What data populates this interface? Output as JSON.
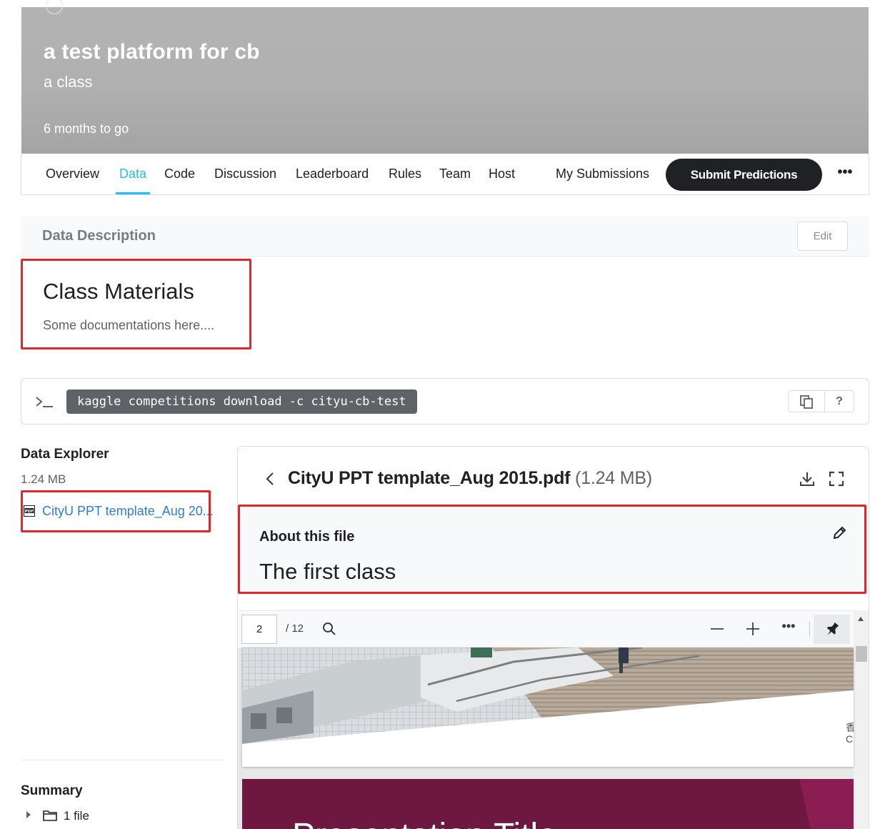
{
  "header": {
    "title": "a test platform for cb",
    "subtitle": "a class",
    "deadline": "6 months to go"
  },
  "tabs": [
    {
      "label": "Overview",
      "active": false
    },
    {
      "label": "Data",
      "active": true
    },
    {
      "label": "Code",
      "active": false
    },
    {
      "label": "Discussion",
      "active": false
    },
    {
      "label": "Leaderboard",
      "active": false
    },
    {
      "label": "Rules",
      "active": false
    },
    {
      "label": "Team",
      "active": false
    },
    {
      "label": "Host",
      "active": false
    },
    {
      "label": "My Submissions",
      "active": false
    }
  ],
  "actions": {
    "submit_label": "Submit Predictions",
    "more_label": "•••"
  },
  "data_description": {
    "title": "Data Description",
    "edit_label": "Edit",
    "heading": "Class Materials",
    "text": "Some documentations here...."
  },
  "command": {
    "text": "kaggle competitions download -c cityu-cb-test",
    "help_label": "?"
  },
  "explorer": {
    "title": "Data Explorer",
    "size": "1.24 MB",
    "files": [
      {
        "name": "CityU PPT template_Aug 2015.pdf",
        "display": "CityU PPT template_Aug 20..."
      }
    ],
    "file_icon_label": "PDF"
  },
  "summary": {
    "title": "Summary",
    "files": "1 file"
  },
  "file_view": {
    "name": "CityU PPT template_Aug 2015.pdf",
    "size": "(1.24 MB)",
    "about_label": "About this file",
    "about_value": "The first class"
  },
  "pdf_viewer": {
    "current_page": "2",
    "total_pages": "/ 12",
    "page_two_text": "Presentation Title",
    "page_one_chars": "香\nCi"
  },
  "colors": {
    "accent": "#20beff",
    "highlight": "#e4252b",
    "primary_button": "#202124",
    "slide_maroon": "#6e1740"
  }
}
